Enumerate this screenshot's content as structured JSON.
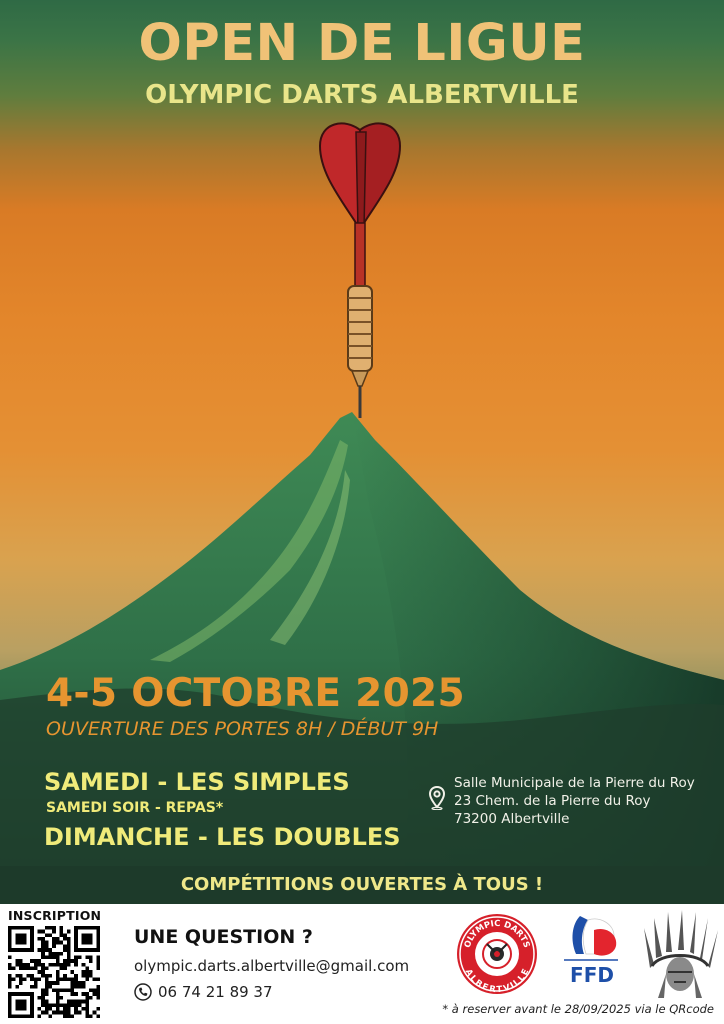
{
  "header": {
    "title": "OPEN DE LIGUE",
    "subtitle": "OLYMPIC DARTS ALBERTVILLE"
  },
  "event": {
    "dates": "4-5 OCTOBRE 2025",
    "doors": "OUVERTURE DES PORTES 8H / DÉBUT 9H",
    "saturday": "SAMEDI - LES SIMPLES",
    "saturday_evening": "SAMEDI SOIR - REPAS*",
    "sunday": "DIMANCHE - LES DOUBLES"
  },
  "venue": {
    "icon": "location-pin-icon",
    "name": "Salle Municipale de la Pierre du Roy",
    "street": "23 Chem. de la Pierre du Roy",
    "city": "73200 Albertville"
  },
  "banner": "COMPÉTITIONS OUVERTES À TOUS !",
  "footer": {
    "inscription_label": "INSCRIPTION",
    "question": "UNE QUESTION ?",
    "email": "olympic.darts.albertville@gmail.com",
    "phone": "06 74 21 89 37",
    "phone_icon": "phone-icon",
    "note": "* à reserver avant le 28/09/2025 via le QRcode",
    "logos": {
      "club_top": "OLYMPIC DARTS",
      "club_bottom": "ALBERTVILLE",
      "federation": "FFD"
    }
  },
  "colors": {
    "title": "#f0c277",
    "subtitle": "#e9e58a",
    "date": "#e69530",
    "schedule": "#f0eb7a",
    "banner_bg": "#1d3a2a"
  }
}
